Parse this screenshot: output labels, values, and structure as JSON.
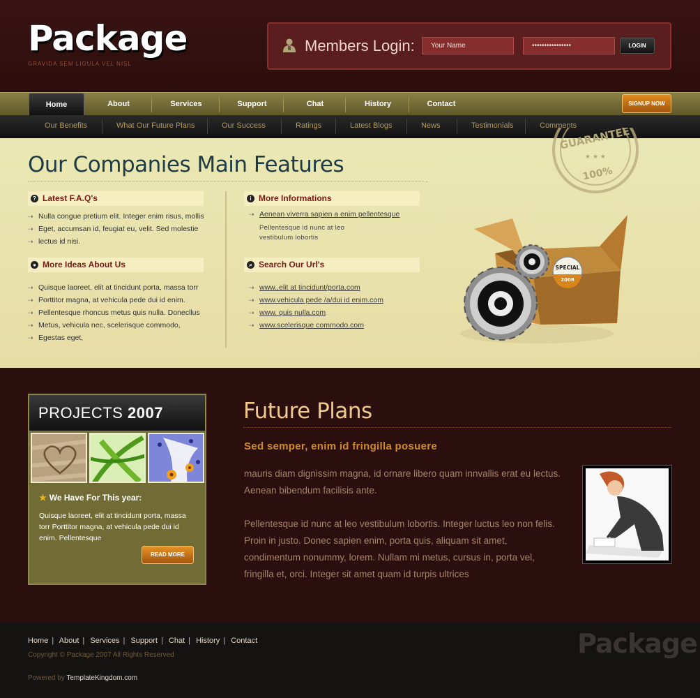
{
  "header": {
    "logo": "Package",
    "tagline": "GRAVIDA SEM LIGULA VEL NISL",
    "login_title": "Members Login:",
    "username_value": "Your Name",
    "password_value": "••••••••••••••••",
    "login_button": "LOGIN"
  },
  "nav": {
    "items": [
      "Home",
      "About",
      "Services",
      "Support",
      "Chat",
      "History",
      "Contact"
    ],
    "signup": "SIGNUP NOW"
  },
  "subnav": {
    "items": [
      "Our Benefits",
      "What Our Future Plans",
      "Our Success",
      "Ratings",
      "Latest Blogs",
      "News",
      "Testimonials",
      "Comments"
    ]
  },
  "features": {
    "title": "Our Companies Main Features",
    "faq": {
      "heading": "Latest F.A.Q's",
      "items": [
        "Nulla congue pretium elit. Integer enim risus, mollis",
        "Eget, accumsan id, feugiat eu, velit. Sed molestie",
        "lectus id nisi."
      ]
    },
    "ideas": {
      "heading": "More Ideas About Us",
      "items": [
        "Quisque laoreet, elit at tincidunt porta, massa torr",
        "Porttitor magna, at vehicula pede dui id enim.",
        "Pellentesque rhoncus metus quis nulla. Donecllus",
        "Metus, vehicula nec, scelerisque commodo,",
        "Egestas eget,"
      ]
    },
    "info": {
      "heading": "More Informations",
      "link": "Aenean viverra sapien a enim pellentesque",
      "text": "Pellentesque id nunc at leo vestibulum lobortis"
    },
    "urls": {
      "heading": "Search Our Url's",
      "items": [
        "www.,elit at tincidunt/porta.com",
        "www.vehicula pede /a/dui id enim.com",
        "www. quis nulla.com",
        "www.scelerisque commodo.com"
      ]
    },
    "stamp_text": "GUARANTEE",
    "stamp_percent": "100%",
    "badge_line1": "SPECIAL",
    "badge_line2": "2008"
  },
  "projects": {
    "title_light": "PROJECTS",
    "title_bold": "2007",
    "year_heading": "We Have For This year:",
    "year_text": "Quisque laoreet, elit at tincidunt porta, massa torr Porttitor magna, at vehicula pede dui id enim. Pellentesque",
    "read_more": "READ MORE"
  },
  "plans": {
    "title": "Future Plans",
    "subtitle": "Sed semper, enim id fringilla posuere",
    "para1": "mauris diam dignissim magna, id ornare libero quam innvallis erat eu lectus. Aenean bibendum facilisis ante.",
    "para2": "Pellentesque id nunc at leo vestibulum lobortis. Integer luctus leo non felis. Proin in justo. Donec sapien enim, porta quis, aliquam sit amet, condimentum nonummy, lorem. Nullam mi metus, cursus in, porta vel, fringilla et, orci. Integer sit amet quam id turpis ultrices"
  },
  "footer": {
    "nav": [
      "Home",
      "About",
      "Services",
      "Support",
      "Chat",
      "History",
      "Contact"
    ],
    "copyright": "Copyright © Package 2007 All Rights Reserved",
    "powered_label": "Powered by",
    "powered_link": "TemplateKingdom.com",
    "logo": "Package"
  },
  "colors": {
    "maroon": "#2b0e0e",
    "olive": "#716c36",
    "cream": "#e9e3ad",
    "orange": "#d08a2a"
  }
}
